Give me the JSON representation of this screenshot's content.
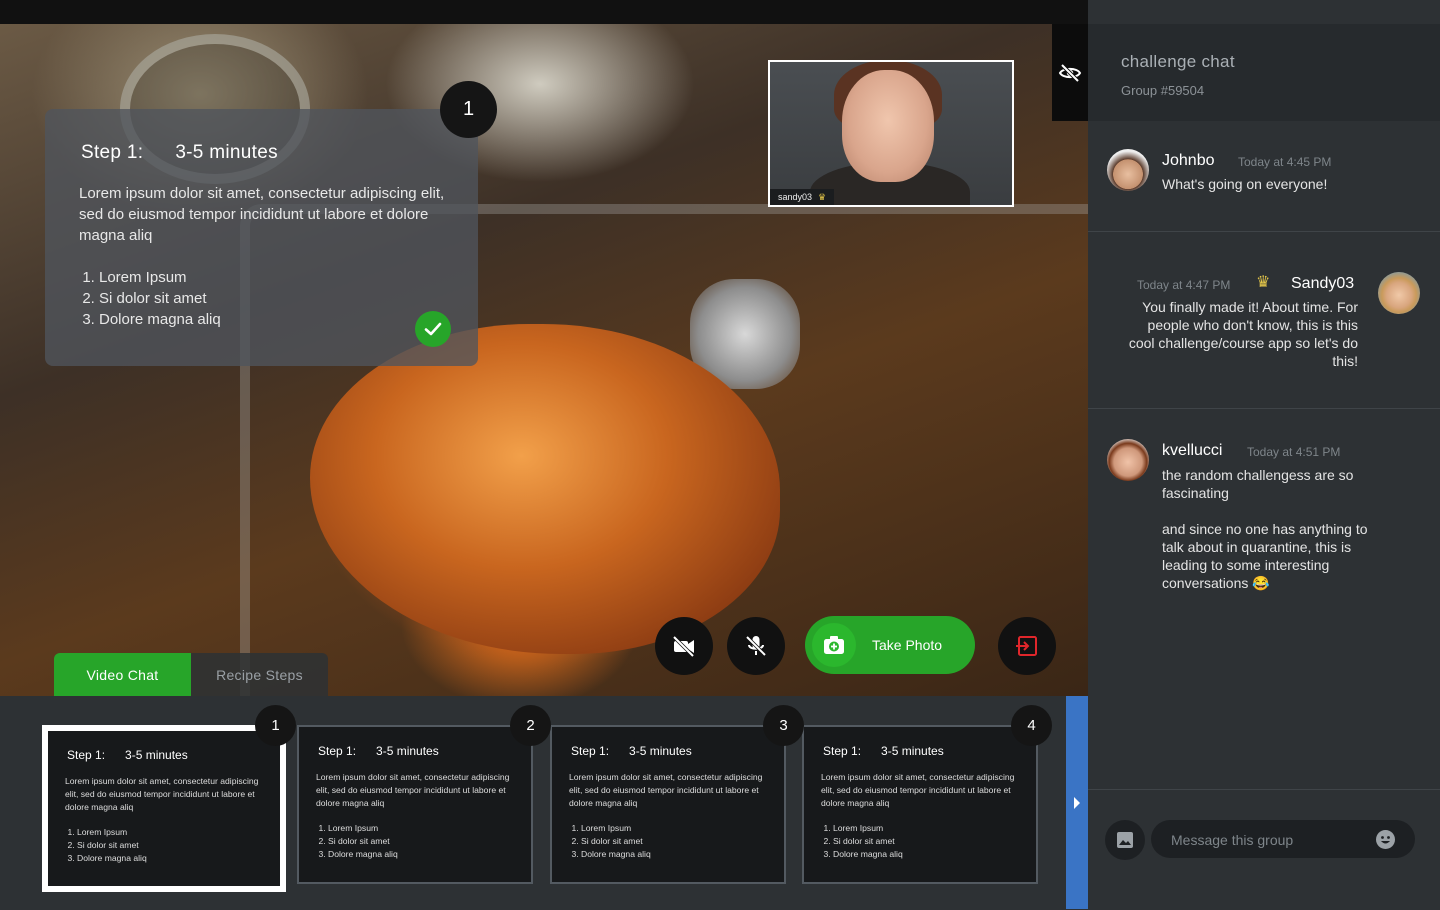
{
  "video": {
    "step_card": {
      "step_label": "Step 1:",
      "duration": "3-5 minutes",
      "number": "1",
      "body": "Lorem ipsum dolor sit amet, consectetur adipiscing elit, sed do eiusmod tempor incididunt ut labore et dolore magna aliq",
      "items": [
        "Lorem Ipsum",
        "Si dolor sit amet",
        "Dolore magna aliq"
      ]
    },
    "pip_username": "sandy03",
    "tabs": [
      {
        "label": "Video Chat",
        "active": true
      },
      {
        "label": "Recipe Steps",
        "active": false
      }
    ],
    "controls": {
      "take_photo_label": "Take Photo"
    },
    "colors": {
      "accent": "#27a529",
      "dark": "#151515",
      "strip_arrow": "#3a74c5"
    }
  },
  "steps": [
    {
      "number": "1",
      "step_label": "Step 1:",
      "duration": "3-5 minutes",
      "line1": "Lorem ipsum dolor sit amet, consectetur adipiscing",
      "line2": "elit, sed do eiusmod tempor incididunt ut labore et",
      "line3": "dolore magna aliq",
      "items": [
        "Lorem Ipsum",
        "Si dolor sit amet",
        "Dolore magna aliq"
      ],
      "selected": true
    },
    {
      "number": "2",
      "step_label": "Step 1:",
      "duration": "3-5 minutes",
      "line1": "Lorem ipsum dolor sit amet, consectetur adipiscing",
      "line2": "elit, sed do eiusmod tempor incididunt ut labore et",
      "line3": "dolore magna aliq",
      "items": [
        "Lorem Ipsum",
        "Si dolor sit amet",
        "Dolore magna aliq"
      ],
      "selected": false
    },
    {
      "number": "3",
      "step_label": "Step 1:",
      "duration": "3-5 minutes",
      "line1": "Lorem ipsum dolor sit amet, consectetur adipiscing",
      "line2": "elit, sed do eiusmod tempor incididunt ut labore et",
      "line3": "dolore magna aliq",
      "items": [
        "Lorem Ipsum",
        "Si dolor sit amet",
        "Dolore magna aliq"
      ],
      "selected": false
    },
    {
      "number": "4",
      "step_label": "Step 1:",
      "duration": "3-5 minutes",
      "line1": "Lorem ipsum dolor sit amet, consectetur adipiscing",
      "line2": "elit, sed do eiusmod tempor incididunt ut labore et",
      "line3": "dolore magna aliq",
      "items": [
        "Lorem Ipsum",
        "Si dolor sit amet",
        "Dolore magna aliq"
      ],
      "selected": false
    }
  ],
  "chat": {
    "title": "challenge chat",
    "group": "Group #59504",
    "messages": [
      {
        "name": "Johnbo",
        "time": "Today at 4:45 PM",
        "text": "What's going on everyone!"
      },
      {
        "name": "Sandy03",
        "time": "Today at 4:47 PM",
        "text": "You finally made it! About time. For people who don't know, this is this cool challenge/course app so let's do this!"
      },
      {
        "name": "kvellucci",
        "time": "Today at 4:51 PM",
        "text1": "the random challengess are so fascinating",
        "text2": "and since no one has anything to talk about in quarantine, this is leading to some interesting conversations 😂"
      }
    ],
    "input_placeholder": "Message this group"
  }
}
